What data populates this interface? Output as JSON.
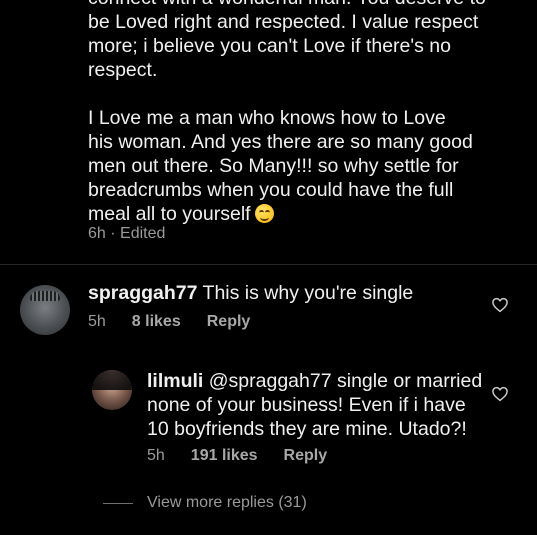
{
  "top_comment": {
    "paragraph_1": "connect with a wonderful man. You deserve to\nbe Loved right and respected. I value respect\nmore; i believe you can't Love if there's no\nrespect.",
    "paragraph_2": "I Love me a man who knows how to Love\nhis woman. And yes there are so many good\nmen out there. So Many!!! so why settle for\nbreadcrumbs when you could have the full\nmeal all to yourself",
    "emoji": "smiling-face-emoji",
    "time": "6h",
    "separator": "·",
    "edited_label": "Edited"
  },
  "comment_1": {
    "username": "spraggah77",
    "text": "This is why you're single",
    "time": "5h",
    "likes": "8 likes",
    "reply_label": "Reply"
  },
  "reply_1": {
    "username": "lilmuli",
    "text": "@spraggah77 single or married none of your business! Even if i have 10 boyfriends they are mine. Utado?!",
    "time": "5h",
    "likes": "191 likes",
    "reply_label": "Reply"
  },
  "view_more": {
    "label": "View more replies (31)"
  },
  "colors": {
    "background": "#000000",
    "text": "#f0f0f0",
    "secondary": "#9a9a9a"
  }
}
